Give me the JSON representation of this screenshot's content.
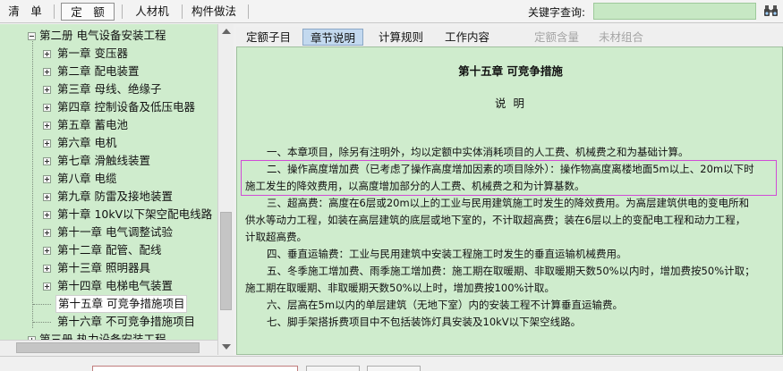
{
  "toolbar": {
    "tabs": [
      "清　单",
      "定　额",
      "人材机",
      "构件做法"
    ],
    "keyword_label": "关键字查询:",
    "keyword_value": ""
  },
  "tree": {
    "root_label": "第二册  电气设备安装工程",
    "chapters": [
      "第一章  变压器",
      "第二章  配电装置",
      "第三章  母线、绝缘子",
      "第四章  控制设备及低压电器",
      "第五章  蓄电池",
      "第六章  电机",
      "第七章  滑触线装置",
      "第八章  电缆",
      "第九章  防雷及接地装置",
      "第十章  10kV以下架空配电线路",
      "第十一章  电气调整试验",
      "第十二章  配管、配线",
      "第十三章  照明器具",
      "第十四章  电梯电气装置",
      "第十五章  可竞争措施项目",
      "第十六章  不可竞争措施项目"
    ],
    "partial_label": "第三册  热力设备安装工程"
  },
  "subtabs": [
    "定额子目",
    "章节说明",
    "计算规则",
    "工作内容",
    "定额含量",
    "未材组合"
  ],
  "content": {
    "title": "第十五章  可竞争措施",
    "subtitle": "说 明",
    "paragraphs": [
      "一、本章项目，除另有注明外，均以定额中实体消耗项目的人工费、机械费之和为基础计算。",
      "二、操作高度增加费（已考虑了操作高度增加因素的项目除外）：操作物高度离楼地面5m以上、20m以下时",
      "施工发生的降效费用，以高度增加部分的人工费、机械费之和为计算基数。",
      "三、超高费：高度在6层或20m以上的工业与民用建筑施工时发生的降效费用。为高层建筑供电的变电所和",
      "供水等动力工程，如装在高层建筑的底层或地下室的，不计取超高费；装在6层以上的变配电工程和动力工程，",
      "计取超高费。",
      "四、垂直运输费：工业与民用建筑中安装工程施工时发生的垂直运输机械费用。",
      "五、冬季施工增加费、雨季施工增加费：施工期在取暖期、非取暖期天数50%以内时，增加费按50%计取；",
      "施工期在取暖期、非取暖期天数50%以上时，增加费按100%计取。",
      "六、层高在5m以内的单层建筑（无地下室）内的安装工程不计算垂直运输费。",
      "七、脚手架搭拆费项目中不包括装饰灯具安装及10kV以下架空线路。"
    ]
  },
  "colors": {
    "panel_green": "#cfeccd",
    "highlight_magenta": "#d04bd6",
    "active_subtab": "#c3d9ef"
  }
}
